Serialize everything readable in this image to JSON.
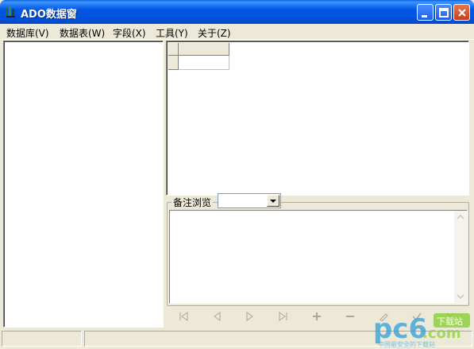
{
  "window": {
    "title": "ADO数据窗",
    "controls": [
      "minimize",
      "maximize",
      "close"
    ]
  },
  "menu": [
    {
      "label": "数据库(V)"
    },
    {
      "label": "数据表(W)"
    },
    {
      "label": "字段(X)"
    },
    {
      "label": "工具(Y)"
    },
    {
      "label": "关于(Z)"
    }
  ],
  "memo": {
    "label": "备注浏览",
    "combo_value": ""
  },
  "navigator": {
    "buttons": [
      "first-icon",
      "prior-icon",
      "next-icon",
      "last-icon",
      "insert-icon",
      "delete-icon",
      "edit-icon",
      "post-icon",
      "cancel-icon"
    ]
  },
  "watermark": {
    "brand": "pc6",
    "suffix": ".com",
    "badge": "下载站",
    "tagline": "中国最安全的下载站"
  },
  "colors": {
    "titlebar": "#0058e6",
    "window_bg": "#ece9d8",
    "close_button": "#c73e14",
    "watermark": "#2f9fd8"
  }
}
